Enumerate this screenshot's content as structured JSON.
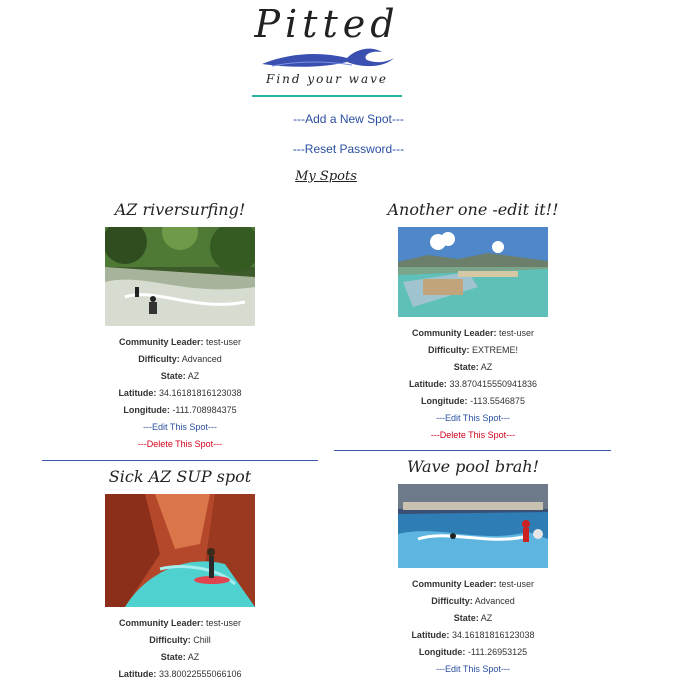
{
  "logo": {
    "title": "Pitted",
    "tagline": "Find your wave"
  },
  "nav": {
    "add_spot": "---Add a New Spot---",
    "reset_password": "---Reset Password---"
  },
  "section_title": "My Spots",
  "labels": {
    "leader": "Community Leader:",
    "difficulty": "Difficulty:",
    "state": "State:",
    "latitude": "Latitude:",
    "longitude": "Longitude:"
  },
  "spots": [
    {
      "name": "AZ riversurfing!",
      "leader": "test-user",
      "difficulty": "Advanced",
      "state": "AZ",
      "latitude": "34.16181816123038",
      "longitude": "-111.708984375",
      "edit": "---Edit This Spot---",
      "delete": "---Delete This Spot---"
    },
    {
      "name": "Another one -edit it!!",
      "leader": "test-user",
      "difficulty": "EXTREME!",
      "state": "AZ",
      "latitude": "33.870415550941836",
      "longitude": "-113.5546875",
      "edit": "---Edit This Spot---",
      "delete": "---Delete This Spot---"
    },
    {
      "name": "Sick AZ SUP spot",
      "leader": "test-user",
      "difficulty": "Chill",
      "state": "AZ",
      "latitude": "33.80022555066106"
    },
    {
      "name": "Wave pool brah!",
      "leader": "test-user",
      "difficulty": "Advanced",
      "state": "AZ",
      "latitude": "34.16181816123038",
      "longitude": "-111.26953125",
      "edit": "---Edit This Spot---"
    }
  ]
}
